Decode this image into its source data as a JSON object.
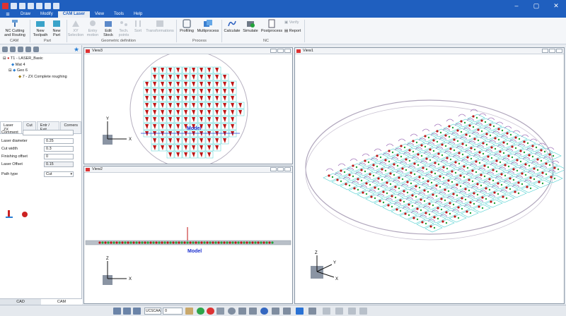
{
  "menu": {
    "items": [
      "Draw",
      "Modify",
      "CAM Laser",
      "View",
      "Tools",
      "Help"
    ],
    "active": "CAM Laser"
  },
  "ribbon": {
    "nc_cutting": "NC Cutting and Routing",
    "new_toolpath": "New Toolpath",
    "new_part": "New Part",
    "xy_selection": "XY Selection",
    "entry_motion": "Entry motion",
    "edit_stock": "Edit Stock",
    "tech_points": "Tech. points",
    "sort": "Sort",
    "transformations": "Transformations",
    "profiling": "Profiling",
    "multiprocess": "Multiprocess",
    "calculate": "Calculate",
    "simulate": "Simulate",
    "postprocess": "Postprocess",
    "verify": "Verify",
    "report": "Report",
    "groups": {
      "cam": "CAM",
      "part": "Part",
      "geometric_definition": "Geometric definition",
      "process": "Process",
      "nc": "NC"
    }
  },
  "tree": {
    "root": "T1 - LASER_Basic",
    "mat": "Mat 4",
    "geo": "Geo 6",
    "op": "7 - ZX Complete roughing"
  },
  "props": {
    "tabs": [
      "Laser ZX",
      "Cut",
      "Entr / Exit",
      "Corners"
    ],
    "rows": [
      {
        "label": "Comment",
        "value": ""
      },
      {
        "label": "Laser diameter",
        "value": "0.25"
      },
      {
        "label": "Cut width",
        "value": "0.3"
      },
      {
        "label": "Finishing offset",
        "value": "0"
      },
      {
        "label": "Laser Offset",
        "value": "0.15"
      },
      {
        "label": "Path type",
        "value": "Cut"
      }
    ]
  },
  "bottom_tabs": [
    "CAD",
    "CAM"
  ],
  "views": {
    "v1": "View1",
    "v2": "View2",
    "v3": "View3"
  },
  "model_label": "Model",
  "status": {
    "ucs": "UCSCAA",
    "layer": "0"
  },
  "colors": {
    "accent": "#1f5fbf",
    "toolpath_red": "#c01515",
    "stock_cyan": "#4fd0d0",
    "geometry_purple": "#9f6fb8"
  }
}
